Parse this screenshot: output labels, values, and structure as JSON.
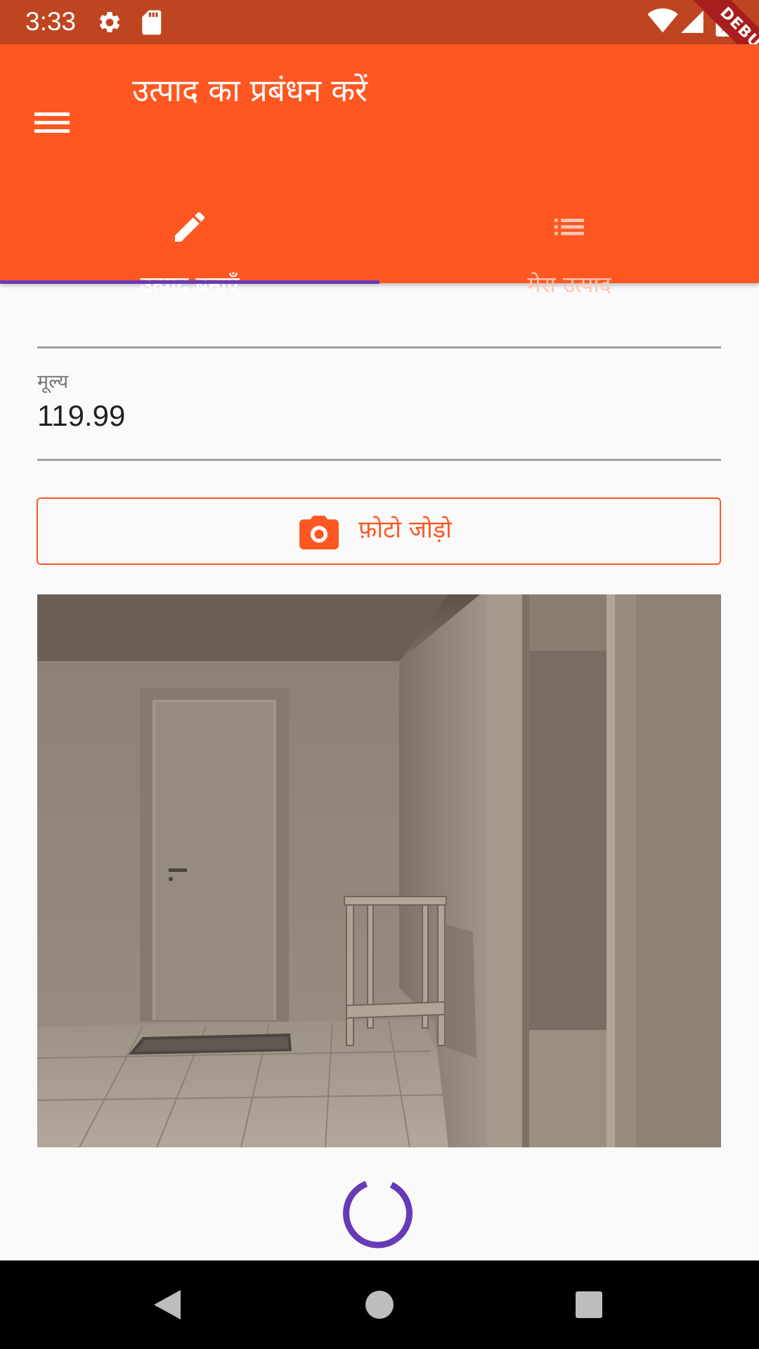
{
  "status_bar": {
    "time": "3:33",
    "icons": [
      "settings-icon",
      "sd-card-icon",
      "wifi-icon",
      "signal-icon",
      "battery-charging-icon"
    ]
  },
  "debug_banner": {
    "label": "DEBUG"
  },
  "app_bar": {
    "menu_icon": "menu-icon",
    "title": "उत्पाद का प्रबंधन करें"
  },
  "tabs": [
    {
      "label": "उत्पाद बनाएँ",
      "icon": "edit-icon",
      "selected": true
    },
    {
      "label": "मेरा उत्पाद",
      "icon": "list-icon",
      "selected": false
    }
  ],
  "form": {
    "price_label": "मूल्य",
    "price_value": "119.99",
    "add_photo_label": "फ़ोटो जोड़ो",
    "add_photo_icon": "camera-icon"
  },
  "loading_icon": "progress-spinner-icon",
  "nav_bar": {
    "icons": [
      "back-icon",
      "home-icon",
      "recents-icon"
    ]
  },
  "colors": {
    "primary": "#ff5722",
    "status_bar": "#bf4520",
    "accent": "#673ab7",
    "debug_banner": "#a81d1d",
    "background": "#fafafa"
  }
}
